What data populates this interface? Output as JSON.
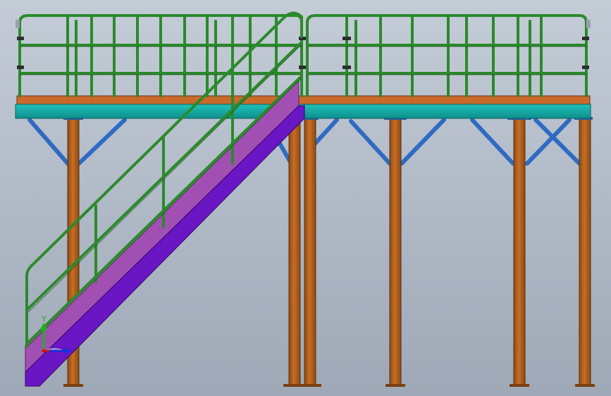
{
  "window": {
    "title": ""
  },
  "viewport": {
    "background_top": "#c4ccd7",
    "background_bottom": "#9ea8b6"
  },
  "model": {
    "description_colors": {
      "column": "#b5621f",
      "column_edge": "#5a2f0c",
      "deck_beam": "#15a7a2",
      "deck_plate": "#c9692a",
      "bracing": "#2f6bc2",
      "railing": "#2b8a2b",
      "railing_edge": "#154d15",
      "stair_side": "#a24fb4",
      "stair_stringer": "#6a16c4"
    }
  },
  "triad": {
    "y_label": "Y",
    "x_color": "#d01010",
    "y_color": "#19b619",
    "z_color": "#1b2fd8"
  }
}
